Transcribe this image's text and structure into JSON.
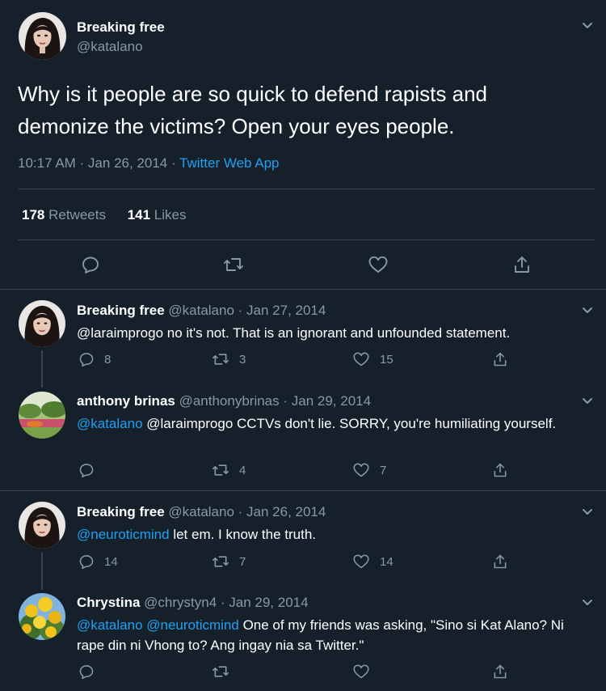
{
  "main_tweet": {
    "display_name": "Breaking free",
    "handle": "@katalano",
    "text": "Why is it people are so quick to defend rapists and demonize the victims? Open your eyes people.",
    "time": "10:17 AM · Jan 26, 2014 · ",
    "source": "Twitter Web App",
    "retweets_count": "178",
    "retweets_label": " Retweets",
    "likes_count": "141",
    "likes_label": " Likes"
  },
  "replies": [
    {
      "display_name": "Breaking free",
      "handle_date": " @katalano · Jan 27, 2014",
      "text": "@laraimprogo no it's not. That is an ignorant and unfounded statement.",
      "reply_count": "8",
      "retweet_count": "3",
      "like_count": "15"
    },
    {
      "display_name": "anthony brinas",
      "handle_date": " @anthonybrinas · Jan 29, 2014",
      "mention": "@katalano",
      "text": " @laraimprogo CCTVs don't lie. SORRY, you're humiliating yourself.",
      "reply_count": "",
      "retweet_count": "4",
      "like_count": "7"
    },
    {
      "display_name": "Breaking free",
      "handle_date": " @katalano · Jan 26, 2014",
      "mention": "@neuroticmind",
      "text": " let em. I know the truth.",
      "reply_count": "14",
      "retweet_count": "7",
      "like_count": "14"
    },
    {
      "display_name": "Chrystina",
      "handle_date": " @chrystyn4 · Jan 29, 2014",
      "mention": "@katalano @neuroticmind",
      "text": " One of my friends was asking, \"Sino si Kat Alano? Ni rape din ni Vhong to? Ang ingay nia sa Twitter.\"",
      "reply_count": "",
      "retweet_count": "",
      "like_count": ""
    }
  ],
  "colors": {
    "background": "#15202b",
    "divider": "#38444d",
    "muted": "#8899a6",
    "link": "#1da1f2"
  }
}
